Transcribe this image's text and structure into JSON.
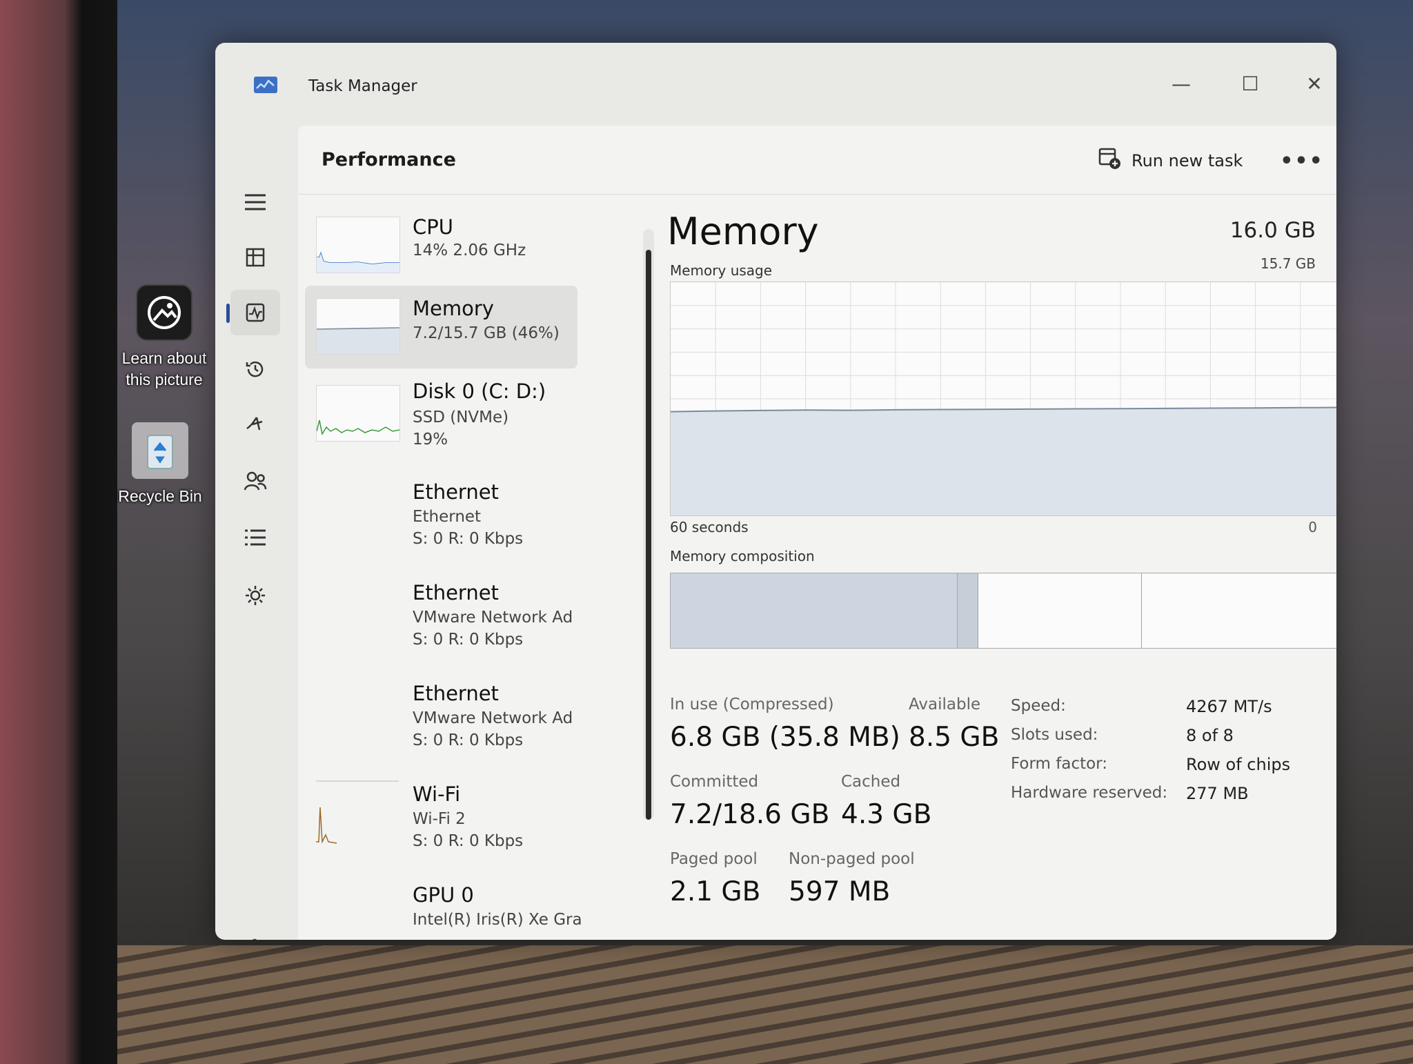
{
  "desktop": {
    "icons": [
      {
        "label_line1": "Learn about",
        "label_line2": "this picture",
        "icon": "learn-about-picture-icon"
      },
      {
        "label_line1": "Recycle Bin",
        "label_line2": "",
        "icon": "recycle-bin-icon"
      }
    ]
  },
  "window": {
    "title": "Task Manager",
    "controls": {
      "minimize": "—",
      "maximize": "☐",
      "close": "✕"
    }
  },
  "nav": {
    "items": [
      "hamburger-menu-icon",
      "processes-icon",
      "performance-icon",
      "app-history-icon",
      "startup-apps-icon",
      "users-icon",
      "details-icon",
      "services-icon"
    ],
    "settings": "settings-icon"
  },
  "header": {
    "page_title": "Performance",
    "run_new_task": "Run new task",
    "more": "•••"
  },
  "devices": [
    {
      "name": "CPU",
      "sub1": "14% 2.06 GHz",
      "sub2": "",
      "sub3": ""
    },
    {
      "name": "Memory",
      "sub1": "7.2/15.7 GB (46%)",
      "sub2": "",
      "sub3": ""
    },
    {
      "name": "Disk 0 (C: D:)",
      "sub1": "SSD (NVMe)",
      "sub2": "19%",
      "sub3": ""
    },
    {
      "name": "Ethernet",
      "sub1": "Ethernet",
      "sub2": "S: 0 R: 0 Kbps",
      "sub3": ""
    },
    {
      "name": "Ethernet",
      "sub1": "VMware Network Ad",
      "sub2": "S: 0 R: 0 Kbps",
      "sub3": ""
    },
    {
      "name": "Ethernet",
      "sub1": "VMware Network Ad",
      "sub2": "S: 0 R: 0 Kbps",
      "sub3": ""
    },
    {
      "name": "Wi-Fi",
      "sub1": "Wi-Fi 2",
      "sub2": "S: 0 R: 0 Kbps",
      "sub3": ""
    },
    {
      "name": "GPU 0",
      "sub1": "Intel(R) Iris(R) Xe Gra",
      "sub2": "",
      "sub3": ""
    }
  ],
  "memory": {
    "title": "Memory",
    "total": "16.0 GB",
    "usage_label": "Memory usage",
    "usage_max": "15.7 GB",
    "graph_left": "60 seconds",
    "graph_right": "0",
    "composition_label": "Memory composition",
    "composition": {
      "in_use_fraction": 0.42,
      "modified_fraction": 0.03,
      "standby_fraction": 0.24,
      "free_fraction": 0.31
    },
    "usage_series_percent": [
      44.5,
      44.8,
      45.0,
      45.2,
      45.1,
      45.3,
      45.4,
      45.5,
      45.6,
      45.7,
      45.8,
      45.9,
      46.0,
      46.1,
      46.2,
      46.3
    ],
    "stats": {
      "in_use_label": "In use (Compressed)",
      "in_use_value": "6.8 GB (35.8 MB)",
      "available_label": "Available",
      "available_value": "8.5 GB",
      "committed_label": "Committed",
      "committed_value": "7.2/18.6 GB",
      "cached_label": "Cached",
      "cached_value": "4.3 GB",
      "paged_label": "Paged pool",
      "paged_value": "2.1 GB",
      "nonpaged_label": "Non-paged pool",
      "nonpaged_value": "597 MB"
    },
    "specs": {
      "speed_label": "Speed:",
      "speed_value": "4267 MT/s",
      "slots_label": "Slots used:",
      "slots_value": "8 of 8",
      "form_label": "Form factor:",
      "form_value": "Row of chips",
      "hw_label": "Hardware reserved:",
      "hw_value": "277 MB"
    }
  },
  "colors": {
    "accent": "#2b4c9b",
    "graph_fill": "#dde3ea",
    "graph_line": "#7a8a9c",
    "in_use": "#cdd6e0"
  }
}
